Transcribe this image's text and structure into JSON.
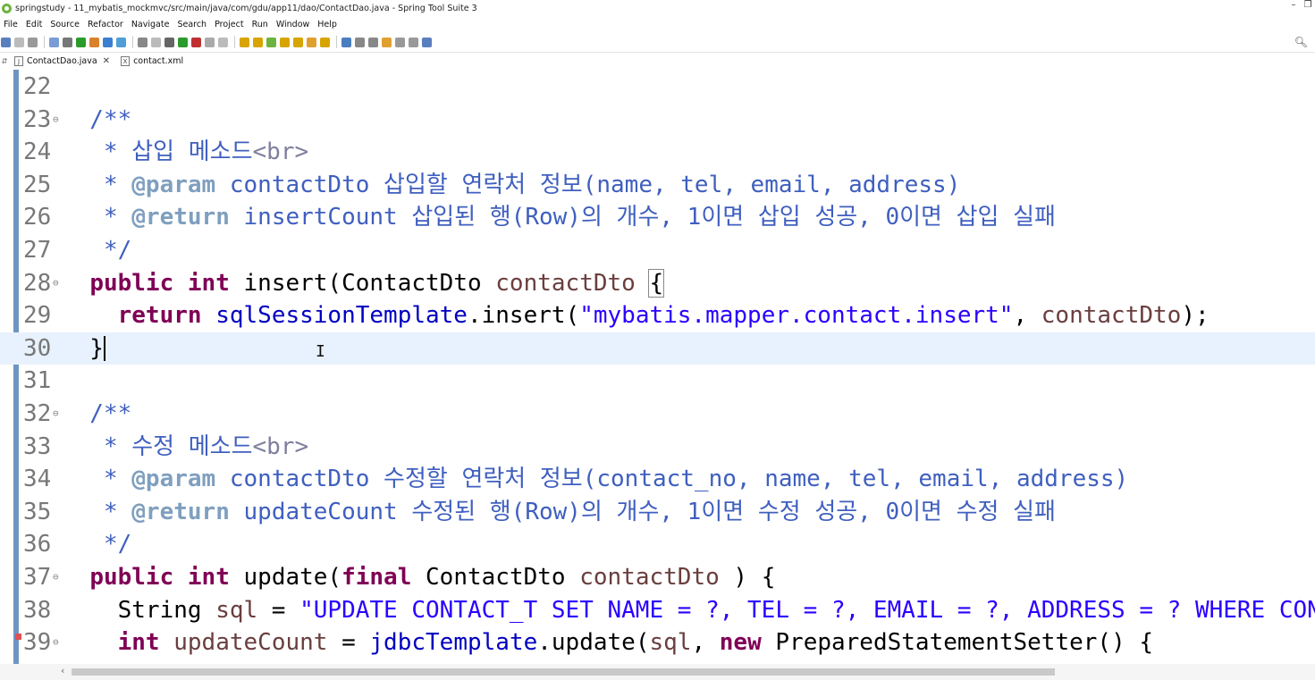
{
  "window": {
    "title": "springstudy - 11_mybatis_mockmvc/src/main/java/com/gdu/app11/dao/ContactDao.java - Spring Tool Suite 3",
    "controls": [
      "–",
      "❐"
    ]
  },
  "menu": [
    "File",
    "Edit",
    "Source",
    "Refactor",
    "Navigate",
    "Search",
    "Project",
    "Run",
    "Window",
    "Help"
  ],
  "toolbar": {
    "icons": [
      "new-icon",
      "save-icon",
      "save-all-icon",
      "print-icon",
      "link-icon",
      "run-server-icon",
      "refresh-icon",
      "pin-icon",
      "highlight-icon",
      "format-icon",
      "markers-icon",
      "debug-icon",
      "run-icon",
      "external-tools-icon",
      "stop-icon",
      "server-icon",
      "open-type-icon",
      "open-task-icon",
      "spring-icon",
      "open-folder-icon",
      "folder-icon",
      "pencil-icon",
      "browse-icon",
      "globe-icon",
      "next-annotation-icon",
      "prev-annotation-icon",
      "last-edit-icon",
      "back-icon",
      "forward-icon",
      "pin-editor-icon"
    ],
    "colors": [
      "#5a7fbf",
      "#bbbbbb",
      "#999999",
      "#7a9cd6",
      "#777777",
      "#2b9b2b",
      "#d9822b",
      "#3b7fd0",
      "#4f9fd6",
      "#888888",
      "#bbbbbb",
      "#666666",
      "#2b9b2b",
      "#c03030",
      "#aaaaaa",
      "#bbbbbb",
      "#d8a400",
      "#d8a400",
      "#6db33f",
      "#d8a400",
      "#d8a400",
      "#e0a030",
      "#d8a400",
      "#4a7ec0",
      "#888888",
      "#888888",
      "#e0a030",
      "#999999",
      "#999999",
      "#5a7fbf"
    ]
  },
  "tabs": [
    {
      "label": "ContactDao.java",
      "icon": "J",
      "active": true,
      "close": "✕"
    },
    {
      "label": "contact.xml",
      "icon": "X",
      "active": false
    }
  ],
  "editor": {
    "lines": [
      {
        "num": "22",
        "fold": "",
        "tokens": []
      },
      {
        "num": "23",
        "fold": "⊖",
        "tokens": [
          [
            "cm",
            "  /**"
          ]
        ]
      },
      {
        "num": "24",
        "fold": "",
        "tokens": [
          [
            "cm",
            "   * 삽입 메소드"
          ],
          [
            "tag",
            "<br>"
          ]
        ]
      },
      {
        "num": "25",
        "fold": "",
        "tokens": [
          [
            "cm",
            "   * "
          ],
          [
            "jd",
            "@param"
          ],
          [
            "cm",
            " contactDto 삽입할 연락처 정보(name, tel, email, address)"
          ]
        ]
      },
      {
        "num": "26",
        "fold": "",
        "tokens": [
          [
            "cm",
            "   * "
          ],
          [
            "jd",
            "@return"
          ],
          [
            "cm",
            " insertCount 삽입된 행(Row)의 개수, 1이면 삽입 성공, 0이면 삽입 실패"
          ]
        ]
      },
      {
        "num": "27",
        "fold": "",
        "tokens": [
          [
            "cm",
            "   */"
          ]
        ]
      },
      {
        "num": "28",
        "fold": "⊖",
        "tokens": [
          [
            "",
            "  "
          ],
          [
            "kw",
            "public"
          ],
          [
            "",
            " "
          ],
          [
            "kw",
            "int"
          ],
          [
            "",
            " insert(ContactDto "
          ],
          [
            "var",
            "contactDto"
          ],
          [
            "",
            " "
          ],
          [
            "box",
            "{"
          ]
        ]
      },
      {
        "num": "29",
        "fold": "",
        "tokens": [
          [
            "",
            "    "
          ],
          [
            "kw",
            "return"
          ],
          [
            "",
            " "
          ],
          [
            "fld",
            "sqlSessionTemplate"
          ],
          [
            "",
            ".insert("
          ],
          [
            "str",
            "\"mybatis.mapper.contact.insert\""
          ],
          [
            "",
            ", "
          ],
          [
            "var",
            "contactDto"
          ],
          [
            "",
            ");"
          ]
        ]
      },
      {
        "num": "30",
        "fold": "",
        "current": true,
        "tokens": [
          [
            "",
            "  }"
          ],
          [
            "caret",
            ""
          ]
        ]
      },
      {
        "num": "31",
        "fold": "",
        "tokens": []
      },
      {
        "num": "32",
        "fold": "⊖",
        "tokens": [
          [
            "cm",
            "  /**"
          ]
        ]
      },
      {
        "num": "33",
        "fold": "",
        "tokens": [
          [
            "cm",
            "   * 수정 메소드"
          ],
          [
            "tag",
            "<br>"
          ]
        ]
      },
      {
        "num": "34",
        "fold": "",
        "tokens": [
          [
            "cm",
            "   * "
          ],
          [
            "jd",
            "@param"
          ],
          [
            "cm",
            " contactDto 수정할 연락처 정보(contact_no, name, tel, email, address)"
          ]
        ]
      },
      {
        "num": "35",
        "fold": "",
        "tokens": [
          [
            "cm",
            "   * "
          ],
          [
            "jd",
            "@return"
          ],
          [
            "cm",
            " updateCount 수정된 행(Row)의 개수, 1이면 수정 성공, 0이면 수정 실패"
          ]
        ]
      },
      {
        "num": "36",
        "fold": "",
        "tokens": [
          [
            "cm",
            "   */"
          ]
        ]
      },
      {
        "num": "37",
        "fold": "⊖",
        "tokens": [
          [
            "",
            "  "
          ],
          [
            "kw",
            "public"
          ],
          [
            "",
            " "
          ],
          [
            "kw",
            "int"
          ],
          [
            "",
            " update("
          ],
          [
            "kw",
            "final"
          ],
          [
            "",
            " ContactDto "
          ],
          [
            "var",
            "contactDto"
          ],
          [
            "",
            " ) {"
          ]
        ]
      },
      {
        "num": "38",
        "fold": "",
        "tokens": [
          [
            "",
            "    String "
          ],
          [
            "var",
            "sql"
          ],
          [
            "",
            " = "
          ],
          [
            "str",
            "\"UPDATE CONTACT_T SET NAME = ?, TEL = ?, EMAIL = ?, ADDRESS = ? WHERE CONTACT_NO = ?\""
          ],
          [
            "",
            ";"
          ]
        ]
      },
      {
        "num": "39",
        "fold": "⊖",
        "tokens": [
          [
            "",
            "    "
          ],
          [
            "kw",
            "int"
          ],
          [
            "",
            " "
          ],
          [
            "var",
            "updateCount"
          ],
          [
            "",
            " = "
          ],
          [
            "fld",
            "jdbcTemplate"
          ],
          [
            "",
            ".update("
          ],
          [
            "var",
            "sql"
          ],
          [
            "",
            ", "
          ],
          [
            "kw",
            "new"
          ],
          [
            "",
            " PreparedStatementSetter() {"
          ]
        ]
      }
    ]
  },
  "scrollbar": {
    "left_arrow": "‹"
  }
}
